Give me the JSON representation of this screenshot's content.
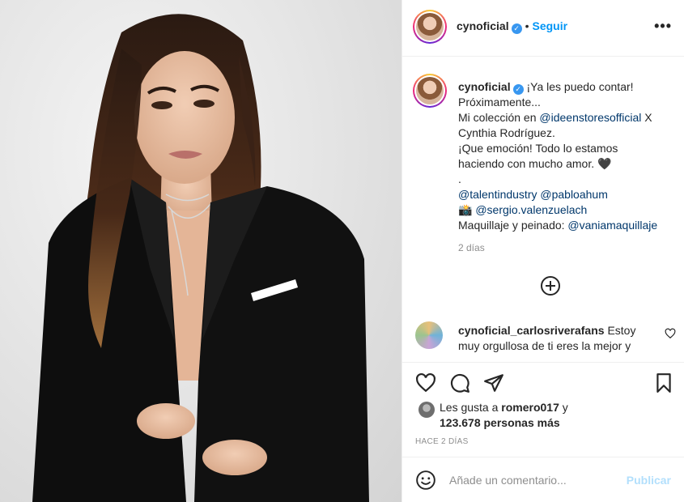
{
  "colors": {
    "link": "#0095f6",
    "mention": "#00376b",
    "muted": "#8e8e8e",
    "publish_disabled": "#b2dffc",
    "verified": "#3897f0"
  },
  "header": {
    "username": "cynoficial",
    "verified_icon": "verified-badge-icon",
    "separator": "•",
    "follow_label": "Seguir",
    "more_label": "•••"
  },
  "caption": {
    "username": "cynoficial",
    "line1": "¡Ya les puedo contar!",
    "line2": "Próximamente...",
    "line3_prefix": "Mi colección en ",
    "line3_mention": "@ideenstoresofficial",
    "line3_suffix": " X",
    "line4": "Cynthia Rodríguez.",
    "line5": "¡Que emoción! Todo lo estamos",
    "line6": "haciendo con mucho amor. 🖤",
    "line7": ".",
    "mention_talent": "@talentindustry",
    "mention_pablo": "@pabloahum",
    "camera_emoji": "📸",
    "mention_sergio": "@sergio.valenzuelach",
    "makeup_prefix": "Maquillaje y peinado: ",
    "mention_vania": "@vaniamaquillaje",
    "time": "2 días"
  },
  "comments": [
    {
      "username": "cynoficial_carlosriverafans",
      "text": "Estoy muy orgullosa de ti eres la mejor y"
    }
  ],
  "likes": {
    "prefix": "Les gusta a ",
    "user": "romero017",
    "middle": " y",
    "count_text": "123.678 personas más"
  },
  "posted_ago": "HACE 2 DÍAS",
  "add_comment": {
    "placeholder": "Añade un comentario...",
    "publish_label": "Publicar"
  },
  "icons": [
    "heart-icon",
    "comment-icon",
    "share-icon",
    "bookmark-icon",
    "emoji-icon",
    "plus-circle-icon",
    "more-options-icon"
  ]
}
